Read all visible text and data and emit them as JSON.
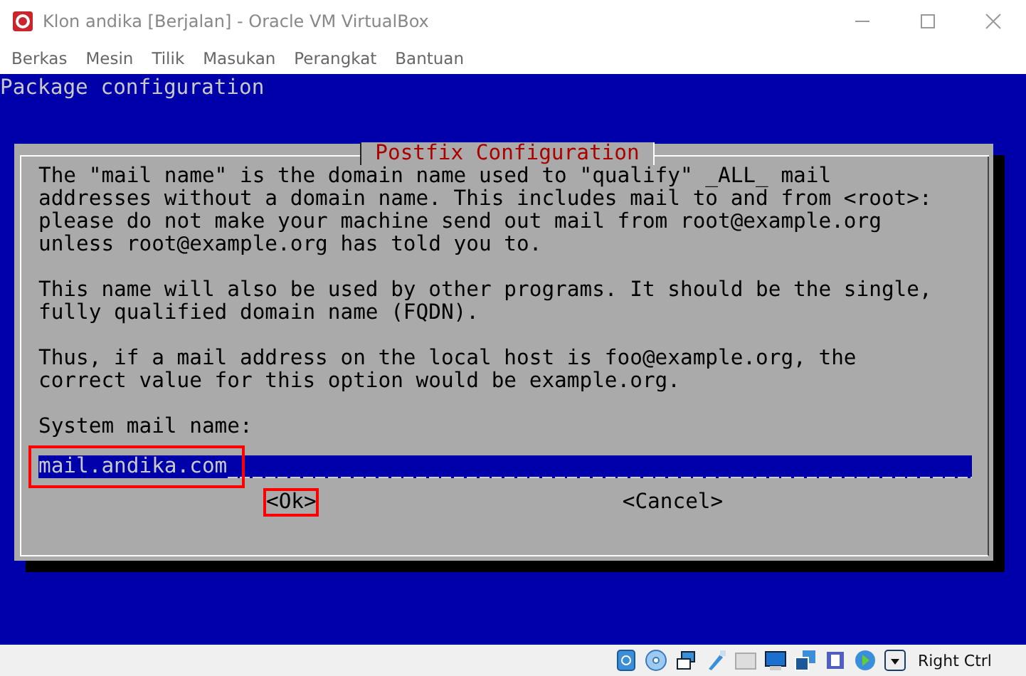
{
  "window": {
    "title": "Klon andika [Berjalan] - Oracle VM VirtualBox"
  },
  "menu": [
    "Berkas",
    "Mesin",
    "Tilik",
    "Masukan",
    "Perangkat",
    "Bantuan"
  ],
  "console": {
    "header": "Package configuration",
    "dialog": {
      "title": "Postfix Configuration",
      "paragraphs": [
        [
          "The \"mail name\" is the domain name used to \"qualify\" _ALL_ mail",
          "addresses without a domain name. This includes mail to and from <root>:",
          "please do not make your machine send out mail from root@example.org",
          "unless root@example.org has told you to."
        ],
        [
          "This name will also be used by other programs. It should be the single,",
          "fully qualified domain name (FQDN)."
        ],
        [
          "Thus, if a mail address on the local host is foo@example.org, the",
          "correct value for this option would be example.org."
        ]
      ],
      "field": {
        "label": "System mail name:",
        "value": "mail.andika.com",
        "highlighted": true
      },
      "buttons": [
        {
          "label": "<Ok>",
          "highlighted": true
        },
        {
          "label": "<Cancel>",
          "highlighted": false
        }
      ]
    }
  },
  "status_bar": {
    "host_key": "Right Ctrl"
  }
}
